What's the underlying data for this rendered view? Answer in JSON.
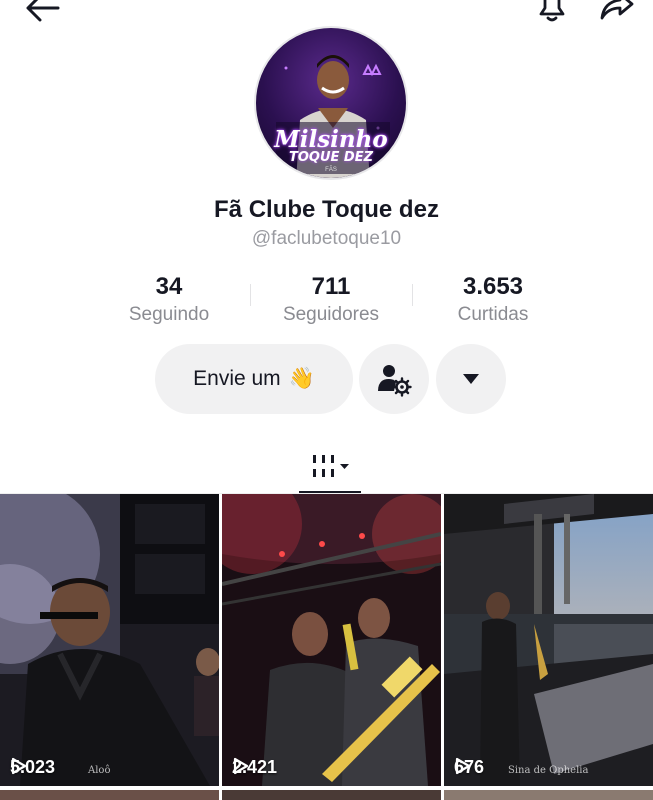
{
  "profile": {
    "display_name": "Fã Clube Toque dez",
    "handle": "@faclubetoque10",
    "avatar": {
      "brand_line1": "Milsinho",
      "brand_line2": "TOQUE DEZ",
      "brand_line3": "FÃS"
    }
  },
  "stats": [
    {
      "value": "34",
      "label": "Seguindo"
    },
    {
      "value": "711",
      "label": "Seguidores"
    },
    {
      "value": "3.653",
      "label": "Curtidas"
    }
  ],
  "actions": {
    "message_label": "Envie um",
    "message_emoji": "👋",
    "friend_icon": "person-gear-icon",
    "more_icon": "caret-down-icon"
  },
  "tabs": {
    "videos_icon": "grid-bars-icon"
  },
  "videos": [
    {
      "views": "5.023",
      "watermark": "Aloô"
    },
    {
      "views": "2.421",
      "watermark": ""
    },
    {
      "views": "676",
      "watermark": "Sina de Ophelia"
    }
  ],
  "colors": {
    "text_primary": "#161823",
    "text_secondary": "#8a8b91",
    "button_bg": "#f1f1f2",
    "avatar_glow": "#b04cff"
  }
}
